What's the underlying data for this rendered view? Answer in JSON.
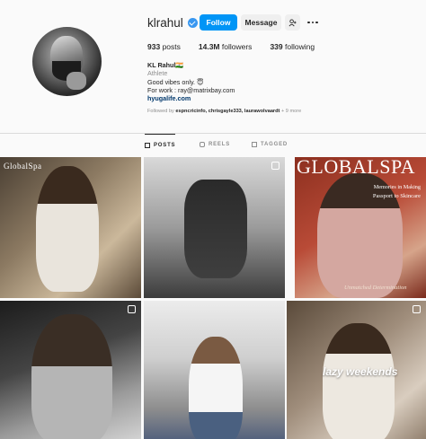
{
  "profile": {
    "username": "klrahul",
    "follow_label": "Follow",
    "message_label": "Message",
    "stats": {
      "posts_value": "933",
      "posts_label": "posts",
      "followers_value": "14.3M",
      "followers_label": "followers",
      "following_value": "339",
      "following_label": "following"
    },
    "bio": {
      "name": "KL Rahul🇮🇳",
      "category": "Athlete",
      "line1": "Good vibes only. 😇",
      "line2": "For work : ray@matrixbay.com",
      "link": "hyugalife.com"
    },
    "followed_by_prefix": "Followed by",
    "followed_by_names": "espncricinfo, chrisgayle333, laurawolvaardt",
    "followed_by_more": "+ 9 more"
  },
  "tabs": [
    {
      "label": "POSTS",
      "icon": "grid-icon",
      "active": true
    },
    {
      "label": "REELS",
      "icon": "reels-icon",
      "active": false
    },
    {
      "label": "TAGGED",
      "icon": "tag-icon",
      "active": false
    }
  ],
  "posts": {
    "p1_brand": "GlobalSpa",
    "p3_brand": "GLOBALSPA",
    "p3_caption1": "Memories in Making",
    "p3_caption2": "Passport to Skincare",
    "p3_script": "Unmatched Determination",
    "p6_overlay": "lazy weekends"
  },
  "colors": {
    "follow_button": "#0095f6",
    "verified_badge": "#3897f0",
    "link_text": "#00376b"
  }
}
